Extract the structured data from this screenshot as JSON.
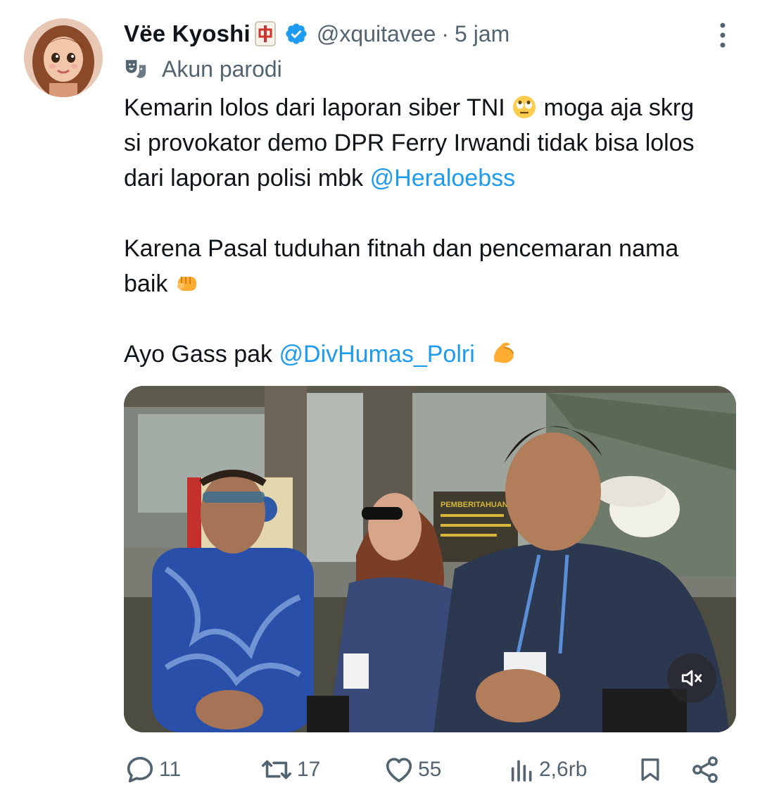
{
  "author": {
    "display_name": "Vëe Kyoshi",
    "handle": "@xquitavee",
    "separator": "·",
    "time": "5 jam",
    "label": "Akun parodi"
  },
  "tweet": {
    "line1_a": "Kemarin lolos dari laporan siber TNI ",
    "line1_b": " moga aja skrg si provokator demo DPR Ferry Irwandi tidak bisa lolos dari laporan polisi mbk ",
    "mention1": "@Heraloebss",
    "para2": "Karena Pasal tuduhan fitnah dan pencemaran nama baik ",
    "para3_a": "Ayo Gass pak ",
    "mention2": "@DivHumas_Polri",
    "emoji_names": [
      "rolling-eyes",
      "oncoming-fist",
      "flexed-biceps"
    ]
  },
  "media": {
    "type": "video",
    "muted": true,
    "sign_text": "PEMBERITAHUAN"
  },
  "actions": {
    "replies": "11",
    "reposts": "17",
    "likes": "55",
    "views": "2,6rb"
  },
  "colors": {
    "accent": "#1d9bf0",
    "secondary_text": "#536471",
    "primary_text": "#0f1419"
  }
}
